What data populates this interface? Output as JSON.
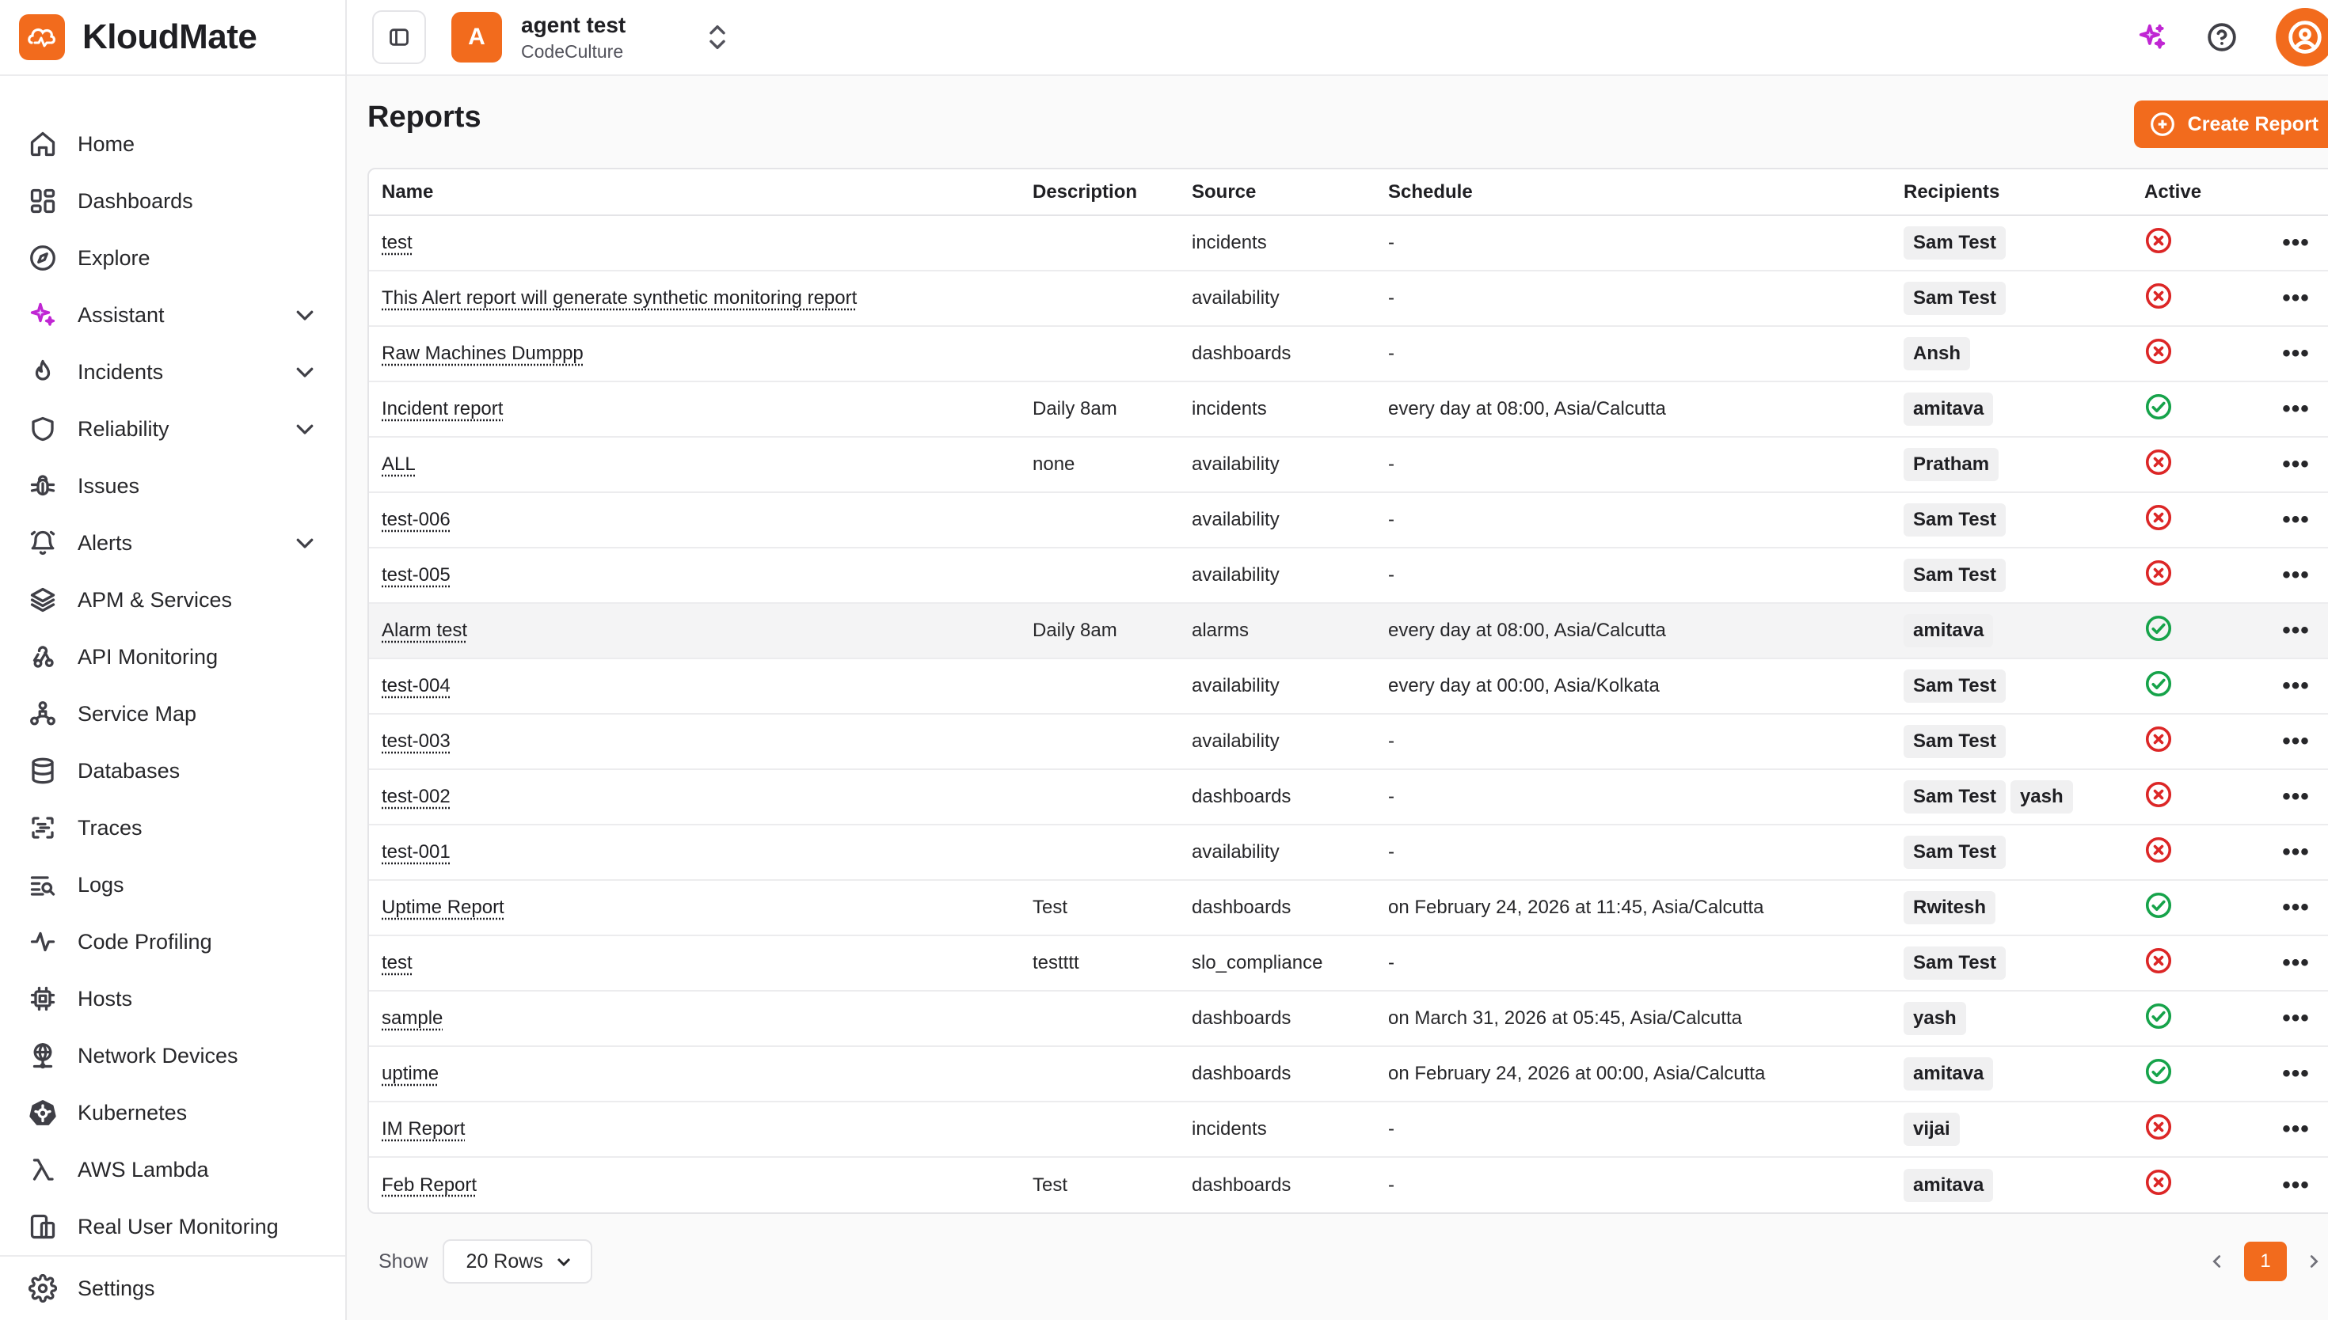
{
  "brand": {
    "name": "KloudMate",
    "accent": "#f26b1d"
  },
  "sidebar": {
    "items": [
      {
        "label": "Home",
        "icon": "home-icon"
      },
      {
        "label": "Dashboards",
        "icon": "dashboard-icon"
      },
      {
        "label": "Explore",
        "icon": "compass-icon"
      },
      {
        "label": "Assistant",
        "icon": "sparkle-icon",
        "expandable": true
      },
      {
        "label": "Incidents",
        "icon": "flame-icon",
        "expandable": true
      },
      {
        "label": "Reliability",
        "icon": "shield-icon",
        "expandable": true
      },
      {
        "label": "Issues",
        "icon": "bug-icon"
      },
      {
        "label": "Alerts",
        "icon": "bell-icon",
        "expandable": true
      },
      {
        "label": "APM & Services",
        "icon": "layers-icon"
      },
      {
        "label": "API Monitoring",
        "icon": "webhook-icon"
      },
      {
        "label": "Service Map",
        "icon": "network-icon"
      },
      {
        "label": "Databases",
        "icon": "database-icon"
      },
      {
        "label": "Traces",
        "icon": "traces-icon"
      },
      {
        "label": "Logs",
        "icon": "logs-icon"
      },
      {
        "label": "Code Profiling",
        "icon": "pulse-icon"
      },
      {
        "label": "Hosts",
        "icon": "cpu-icon"
      },
      {
        "label": "Network Devices",
        "icon": "globe-icon"
      },
      {
        "label": "Kubernetes",
        "icon": "kubernetes-icon"
      },
      {
        "label": "AWS Lambda",
        "icon": "lambda-icon"
      },
      {
        "label": "Real User Monitoring",
        "icon": "devices-icon"
      }
    ],
    "settings_label": "Settings"
  },
  "topbar": {
    "org_initial": "A",
    "org_name": "agent test",
    "org_sub": "CodeCulture"
  },
  "page": {
    "title": "Reports",
    "create_label": "Create Report"
  },
  "table": {
    "columns": [
      "Name",
      "Description",
      "Source",
      "Schedule",
      "Recipients",
      "Active"
    ],
    "rows": [
      {
        "name": "test",
        "description": "",
        "source": "incidents",
        "schedule": "-",
        "recipients": [
          "Sam Test"
        ],
        "active": false
      },
      {
        "name": "This Alert report will generate synthetic monitoring report",
        "description": "",
        "source": "availability",
        "schedule": "-",
        "recipients": [
          "Sam Test"
        ],
        "active": false
      },
      {
        "name": "Raw Machines Dumppp",
        "description": "",
        "source": "dashboards",
        "schedule": "-",
        "recipients": [
          "Ansh"
        ],
        "active": false
      },
      {
        "name": "Incident report",
        "description": "Daily 8am",
        "source": "incidents",
        "schedule": "every day at 08:00, Asia/Calcutta",
        "recipients": [
          "amitava"
        ],
        "active": true
      },
      {
        "name": "ALL",
        "description": "none",
        "source": "availability",
        "schedule": "-",
        "recipients": [
          "Pratham"
        ],
        "active": false
      },
      {
        "name": "test-006",
        "description": "",
        "source": "availability",
        "schedule": "-",
        "recipients": [
          "Sam Test"
        ],
        "active": false
      },
      {
        "name": "test-005",
        "description": "",
        "source": "availability",
        "schedule": "-",
        "recipients": [
          "Sam Test"
        ],
        "active": false
      },
      {
        "name": "Alarm test",
        "description": "Daily 8am",
        "source": "alarms",
        "schedule": "every day at 08:00, Asia/Calcutta",
        "recipients": [
          "amitava"
        ],
        "active": true,
        "highlight": true
      },
      {
        "name": "test-004",
        "description": "",
        "source": "availability",
        "schedule": "every day at 00:00, Asia/Kolkata",
        "recipients": [
          "Sam Test"
        ],
        "active": true
      },
      {
        "name": "test-003",
        "description": "",
        "source": "availability",
        "schedule": "-",
        "recipients": [
          "Sam Test"
        ],
        "active": false
      },
      {
        "name": "test-002",
        "description": "",
        "source": "dashboards",
        "schedule": "-",
        "recipients": [
          "Sam Test",
          "yash"
        ],
        "active": false
      },
      {
        "name": "test-001",
        "description": "",
        "source": "availability",
        "schedule": "-",
        "recipients": [
          "Sam Test"
        ],
        "active": false
      },
      {
        "name": "Uptime Report",
        "description": "Test",
        "source": "dashboards",
        "schedule": "on February 24, 2026 at 11:45, Asia/Calcutta",
        "recipients": [
          "Rwitesh"
        ],
        "active": true
      },
      {
        "name": "test",
        "description": "testttt",
        "source": "slo_compliance",
        "schedule": "-",
        "recipients": [
          "Sam Test"
        ],
        "active": false
      },
      {
        "name": "sample",
        "description": "",
        "source": "dashboards",
        "schedule": "on March 31, 2026 at 05:45, Asia/Calcutta",
        "recipients": [
          "yash"
        ],
        "active": true
      },
      {
        "name": "uptime",
        "description": "",
        "source": "dashboards",
        "schedule": "on February 24, 2026 at 00:00, Asia/Calcutta",
        "recipients": [
          "amitava"
        ],
        "active": true
      },
      {
        "name": "IM Report",
        "description": "",
        "source": "incidents",
        "schedule": "-",
        "recipients": [
          "vijai"
        ],
        "active": false
      },
      {
        "name": "Feb Report",
        "description": "Test",
        "source": "dashboards",
        "schedule": "-",
        "recipients": [
          "amitava"
        ],
        "active": false
      }
    ],
    "row_actions_label": "•••"
  },
  "footer": {
    "show_label": "Show",
    "rows_value": "20 Rows",
    "current_page": "1"
  },
  "colors": {
    "active_ok": "#16a34a",
    "inactive": "#dc2626",
    "ai_sparkle": "#c026d3"
  }
}
